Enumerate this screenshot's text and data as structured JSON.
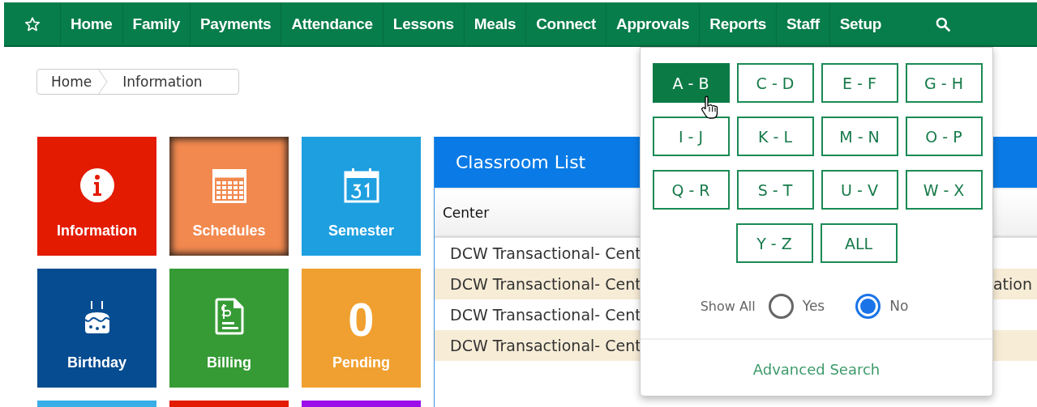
{
  "nav": {
    "items": [
      {
        "label": "Home"
      },
      {
        "label": "Family"
      },
      {
        "label": "Payments"
      },
      {
        "label": "Attendance"
      },
      {
        "label": "Lessons"
      },
      {
        "label": "Meals"
      },
      {
        "label": "Connect"
      },
      {
        "label": "Approvals"
      },
      {
        "label": "Reports"
      },
      {
        "label": "Staff"
      },
      {
        "label": "Setup"
      }
    ]
  },
  "breadcrumb": [
    "Home",
    "Information"
  ],
  "tiles": [
    {
      "kind": "info",
      "label": "Information",
      "color": "#e31b00",
      "highlighted": false
    },
    {
      "kind": "calendar",
      "label": "Schedules",
      "color": "#f2894f",
      "highlighted": true
    },
    {
      "kind": "date",
      "label": "Semester",
      "color": "#1e9fe0",
      "highlighted": false
    },
    {
      "kind": "cake",
      "label": "Birthday",
      "color": "#054c91",
      "highlighted": false
    },
    {
      "kind": "bill",
      "label": "Billing",
      "color": "#369b35",
      "highlighted": false
    },
    {
      "kind": "count",
      "label": "Pending",
      "count": "0",
      "color": "#f0a030",
      "highlighted": false
    },
    {
      "kind": "blank",
      "color": "#3aaee6",
      "highlighted": false
    },
    {
      "kind": "blank",
      "color": "#e31b00",
      "highlighted": false
    },
    {
      "kind": "blank",
      "color": "#9b10ea",
      "highlighted": false
    }
  ],
  "classroom_list": {
    "title": "Classroom List",
    "columns": [
      "Center"
    ],
    "rows": [
      {
        "center": "DCW Transactional- Cent"
      },
      {
        "center": "DCW Transactional- Cent",
        "column_2": "ation"
      },
      {
        "center": "DCW Transactional- Cent"
      },
      {
        "center": "DCW Transactional- Cent"
      }
    ]
  },
  "dropdown": {
    "ranges": [
      {
        "label": "A - B",
        "selected": true
      },
      {
        "label": "C - D",
        "selected": false
      },
      {
        "label": "E - F",
        "selected": false
      },
      {
        "label": "G - H",
        "selected": false
      },
      {
        "label": "I - J",
        "selected": false
      },
      {
        "label": "K - L",
        "selected": false
      },
      {
        "label": "M - N",
        "selected": false
      },
      {
        "label": "O - P",
        "selected": false
      },
      {
        "label": "Q - R",
        "selected": false
      },
      {
        "label": "S - T",
        "selected": false
      },
      {
        "label": "U - V",
        "selected": false
      },
      {
        "label": "W - X",
        "selected": false
      },
      {
        "label": "Y - Z",
        "selected": false
      },
      {
        "label": "ALL",
        "selected": false
      }
    ],
    "show_all": {
      "label": "Show All",
      "options": [
        {
          "label": "Yes",
          "selected": false
        },
        {
          "label": "No",
          "selected": true
        }
      ]
    },
    "advanced_search": "Advanced Search"
  }
}
